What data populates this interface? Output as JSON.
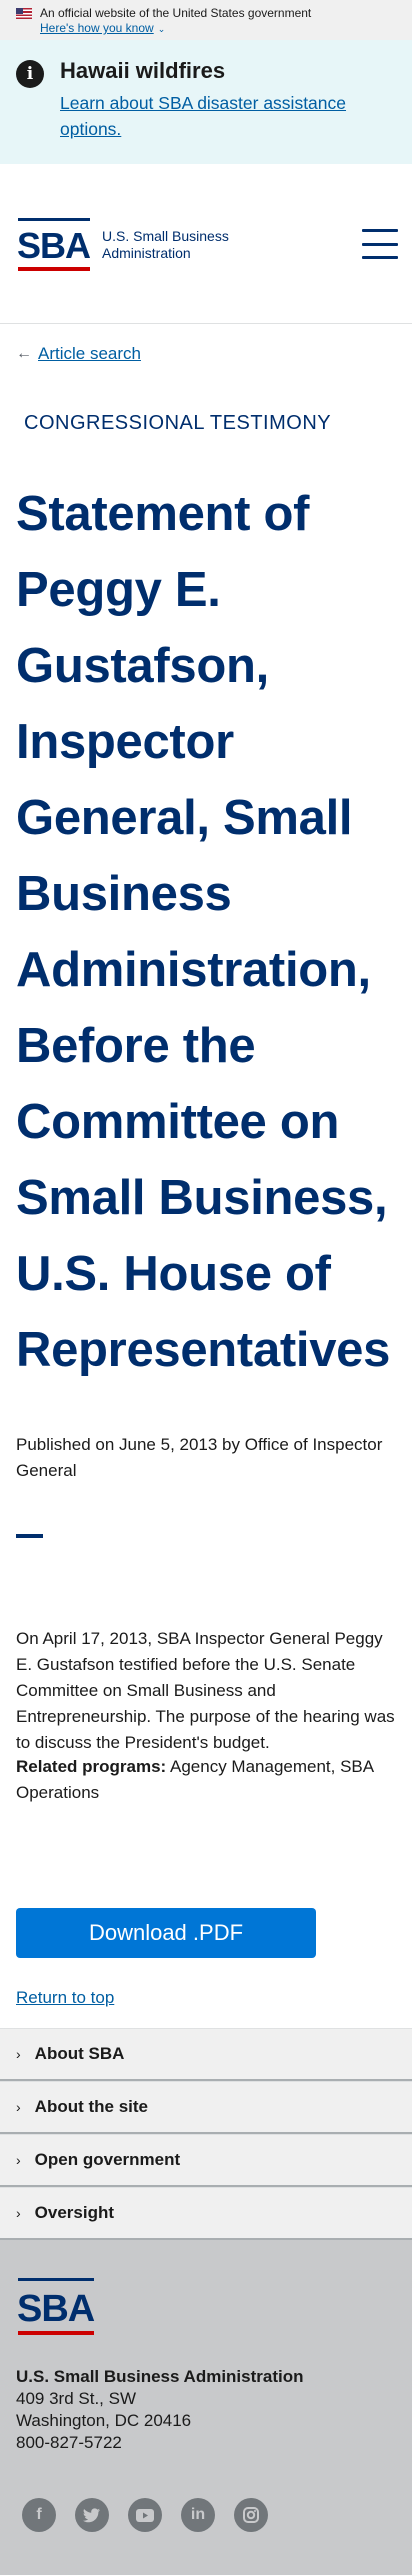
{
  "gov_banner": {
    "official_text": "An official website of the United States government",
    "how_link": "Here's how you know"
  },
  "alert": {
    "title": "Hawaii wildfires",
    "link": "Learn about SBA disaster assistance options."
  },
  "header": {
    "logo_text_line1": "U.S. Small Business",
    "logo_text_line2": "Administration"
  },
  "breadcrumb": {
    "label": "Article search"
  },
  "article": {
    "category": "CONGRESSIONAL TESTIMONY",
    "title": "Statement of Peggy E. Gustafson, Inspector General, Small Business Administration, Before the Committee on Small Business, U.S. House of Representatives",
    "published": "Published on June 5, 2013 by Office of Inspector General",
    "body": "On April 17, 2013,  SBA Inspector General Peggy E. Gustafson testified before the U.S. Senate Committee on Small Business and Entrepreneurship.  The purpose of the hearing was to discuss the President's budget.",
    "related_label": "Related programs:",
    "related_value": " Agency Management, SBA Operations",
    "download_label": "Download .PDF",
    "return_top": "Return to top"
  },
  "footer_nav": [
    {
      "label": "About SBA"
    },
    {
      "label": "About the site"
    },
    {
      "label": "Open government"
    },
    {
      "label": "Oversight"
    }
  ],
  "footer": {
    "org_name": "U.S. Small Business Administration",
    "address1": "409 3rd St., SW",
    "address2": "Washington, DC 20416",
    "phone": "800-827-5722",
    "social": [
      "facebook-icon",
      "twitter-icon",
      "youtube-icon",
      "linkedin-icon",
      "instagram-icon"
    ]
  },
  "colors": {
    "navy": "#002e6d",
    "link": "#005ea2",
    "button": "#0076d6",
    "alert_bg": "#e7f6f8",
    "brand_red": "#cc0000"
  }
}
